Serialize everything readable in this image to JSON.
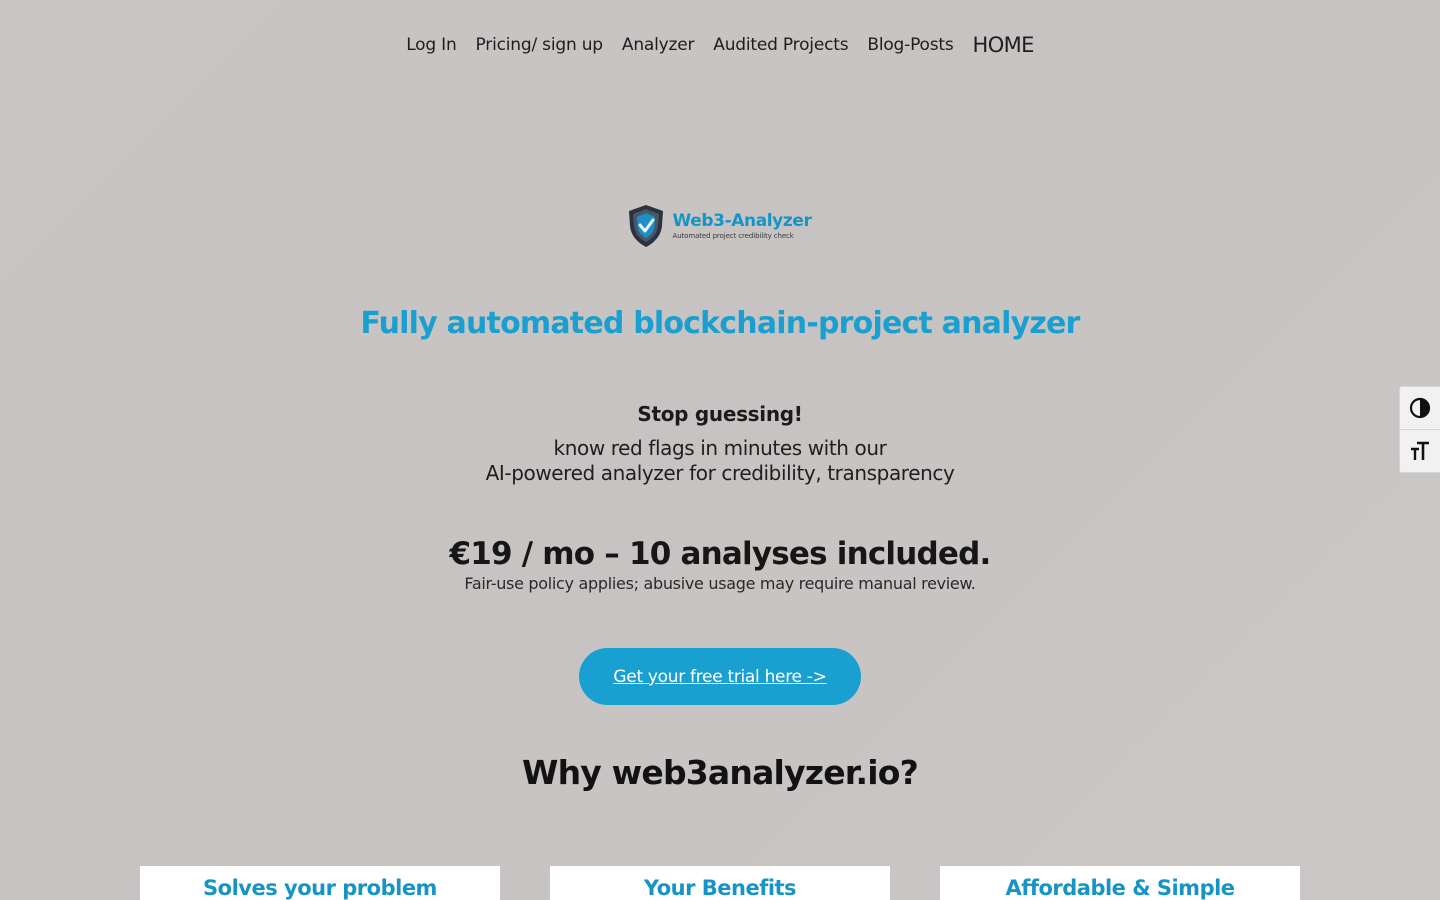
{
  "nav": {
    "items": [
      {
        "label": "Log In"
      },
      {
        "label": "Pricing/ sign up"
      },
      {
        "label": "Analyzer"
      },
      {
        "label": "Audited Projects"
      },
      {
        "label": "Blog-Posts"
      },
      {
        "label": "HOME"
      }
    ]
  },
  "logo": {
    "brand": "Web3-Analyzer",
    "tagline": "Automated project credibility check",
    "icon": "shield-check-icon"
  },
  "hero": {
    "headline": "Fully automated blockchain-project analyzer",
    "stop": "Stop guessing!",
    "intro_line1": "know red flags in minutes with our",
    "intro_line2": "AI-powered analyzer for credibility, transparency",
    "price": "€19 / mo – 10 analyses included.",
    "fair_use": "Fair-use policy applies; abusive usage may require manual review.",
    "cta": "Get your free trial here ->"
  },
  "why": {
    "title": "Why web3analyzer.io?",
    "cards": [
      {
        "title": "Solves your problem"
      },
      {
        "title": "Your Benefits"
      },
      {
        "title": "Affordable & Simple"
      }
    ]
  },
  "accessibility": {
    "contrast_icon": "contrast-icon",
    "font_size_icon": "font-size-icon"
  },
  "colors": {
    "accent": "#1aa0d0",
    "background": "#c8c4c3",
    "card": "#ffffff"
  }
}
